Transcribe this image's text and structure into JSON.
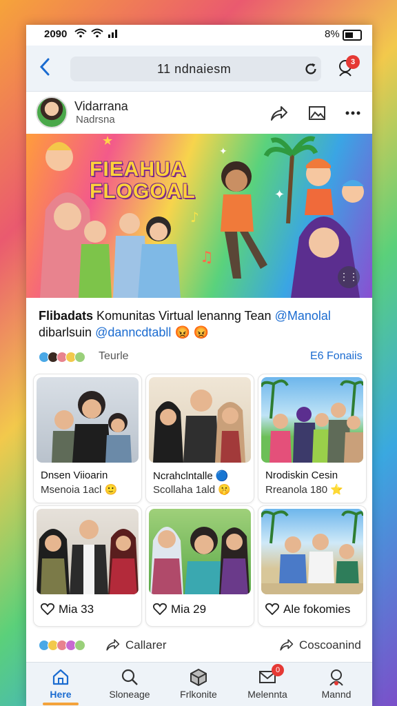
{
  "status": {
    "time": "2090",
    "battery": "8%"
  },
  "browser": {
    "url": "11 ndnaiesm",
    "notifications": "3"
  },
  "profile": {
    "name": "Vidarrana",
    "subtitle": "Nadrsna"
  },
  "banner": {
    "title_line1": "FIEAHUA",
    "title_line2": "FLOGOAL"
  },
  "post": {
    "author": "Flibadats",
    "text": "Komunitas Virtual lenanng Tean",
    "mention1": "@Manolal",
    "line2": "dibarlsuin",
    "mention2": "@danncdtabll",
    "emoji": "😡 😡"
  },
  "meta": {
    "label": "Teurle",
    "right": "E6 Fonaiis"
  },
  "cards": [
    {
      "title": "Dnsen Viioarin",
      "subtitle": "Msenoia 1acl 🙂"
    },
    {
      "title": "Ncrahclntalle 🔵",
      "subtitle": "Scollaha 1ald 🤫"
    },
    {
      "title": "Nrodiskin Cesin",
      "subtitle": "Rreanola 180 ⭐"
    }
  ],
  "cards2": [
    {
      "likes": "Mia 33"
    },
    {
      "likes": "Mia 29"
    },
    {
      "likes": "Ale fokomies"
    }
  ],
  "actions": {
    "share": "Callarer",
    "comment": "Coscoanind"
  },
  "nav": [
    {
      "label": "Here"
    },
    {
      "label": "Sloneage"
    },
    {
      "label": "Frlkonite"
    },
    {
      "label": "Melennta",
      "badge": "0"
    },
    {
      "label": "Mannd"
    }
  ],
  "colors": {
    "accent": "#1a6bd0",
    "badge": "#e53935",
    "nav_indicator": "#f4a23a"
  }
}
